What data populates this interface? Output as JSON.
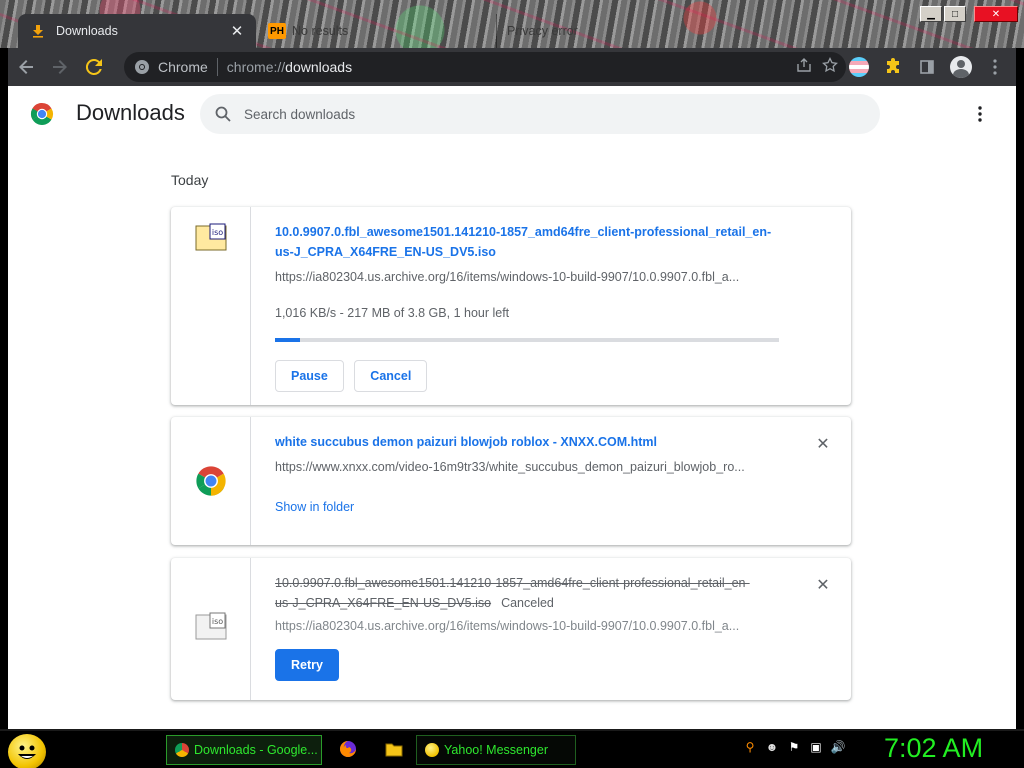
{
  "browser": {
    "tabs": [
      {
        "title": "Downloads",
        "active": true
      },
      {
        "title": "No results",
        "favicon": "PH",
        "active": false
      },
      {
        "title": "Privacy error",
        "active": false
      }
    ],
    "omnibox": {
      "site": "Chrome",
      "url_scheme": "chrome://",
      "url_host": "downloads"
    }
  },
  "page": {
    "title": "Downloads",
    "search_placeholder": "Search downloads",
    "section_label": "Today"
  },
  "downloads": [
    {
      "name_line1": "10.0.9907.0.fbl_awesome1501.141210-1857_amd64fre_client-professional_retail_en-",
      "name_line2": "us-J_CPRA_X64FRE_EN-US_DV5.iso",
      "url": "https://ia802304.us.archive.org/16/items/windows-10-build-9907/10.0.9907.0.fbl_a...",
      "progress_text": "1,016 KB/s - 217 MB of 3.8 GB, 1 hour left",
      "progress_fraction": 0.05,
      "pause_label": "Pause",
      "cancel_label": "Cancel",
      "icon": "iso-file-icon"
    },
    {
      "name": "white succubus demon paizuri blowjob roblox - XNXX.COM.html",
      "url": "https://www.xnxx.com/video-16m9tr33/white_succubus_demon_paizuri_blowjob_ro...",
      "show_in_folder": "Show in folder",
      "icon": "chrome-icon"
    },
    {
      "name_line1": "10.0.9907.0.fbl_awesome1501.141210-1857_amd64fre_client-professional_retail_en-",
      "name_line2": "us-J_CPRA_X64FRE_EN-US_DV5.iso",
      "status": "Canceled",
      "url": "https://ia802304.us.archive.org/16/items/windows-10-build-9907/10.0.9907.0.fbl_a...",
      "retry_label": "Retry",
      "icon": "iso-file-icon"
    }
  ],
  "taskbar": {
    "tasks": [
      {
        "label": "Downloads - Google...",
        "active": true
      },
      {
        "label": "Yahoo! Messenger",
        "active": false
      }
    ],
    "clock": "7:02 AM"
  }
}
